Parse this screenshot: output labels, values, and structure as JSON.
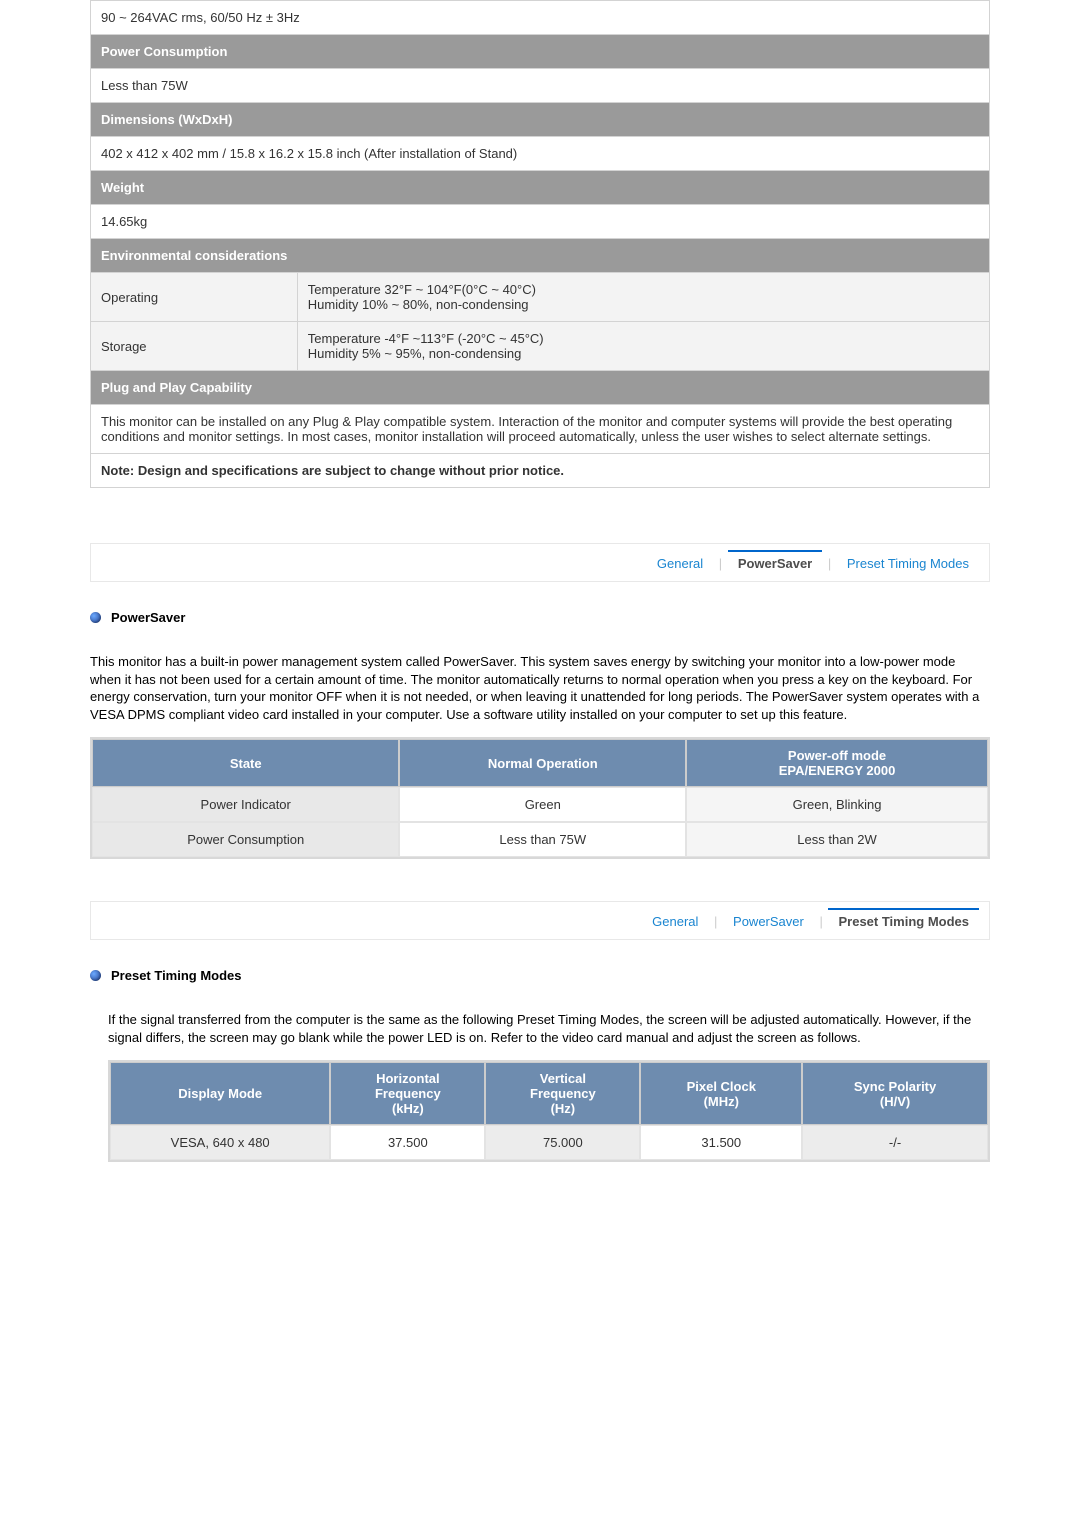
{
  "specs": {
    "voltage": "90 ~ 264VAC rms, 60/50 Hz ± 3Hz",
    "power_consumption_header": "Power Consumption",
    "power_consumption_value": "Less than 75W",
    "dimensions_header": "Dimensions (WxDxH)",
    "dimensions_value": "402 x 412 x 402 mm / 15.8 x 16.2 x 15.8 inch (After installation of Stand)",
    "weight_header": "Weight",
    "weight_value": "14.65kg",
    "env_header": "Environmental considerations",
    "operating_label": "Operating",
    "operating_value": "Temperature 32°F ~ 104°F(0°C ~ 40°C)\nHumidity 10% ~ 80%, non-condensing",
    "storage_label": "Storage",
    "storage_value": "Temperature -4°F ~113°F (-20°C ~ 45°C)\nHumidity 5% ~ 95%, non-condensing",
    "pnp_header": "Plug and Play Capability",
    "pnp_text": "This monitor can be installed on any Plug & Play compatible system. Interaction of the monitor and computer systems will provide the best operating conditions and monitor settings. In most cases, monitor installation will proceed automatically, unless the user wishes to select alternate settings.",
    "note": "Note: Design and specifications are subject to change without prior notice."
  },
  "tabs": {
    "general": "General",
    "powersaver": "PowerSaver",
    "preset": "Preset Timing Modes"
  },
  "powersaver": {
    "title": "PowerSaver",
    "desc": "This monitor has a built-in power management system called PowerSaver. This system saves energy by switching your monitor into a low-power mode when it has not been used for a certain amount of time. The monitor automatically returns to normal operation when you press a key on the keyboard. For energy conservation, turn your monitor OFF when it is not needed, or when leaving it unattended for long periods. The PowerSaver system operates with a VESA DPMS compliant video card installed in your computer. Use a software utility installed on your computer to set up this feature.",
    "col_state": "State",
    "col_normal": "Normal Operation",
    "col_off": "Power-off mode\nEPA/ENERGY 2000",
    "row1_label": "Power Indicator",
    "row1_normal": "Green",
    "row1_off": "Green, Blinking",
    "row2_label": "Power Consumption",
    "row2_normal": "Less than 75W",
    "row2_off": "Less than 2W"
  },
  "preset": {
    "title": "Preset Timing Modes",
    "desc": "If the signal transferred from the computer is the same as the following Preset Timing Modes, the screen will be adjusted automatically. However, if the signal differs, the screen may go blank while the power LED is on. Refer to the video card manual and adjust the screen as follows.",
    "col_mode": "Display Mode",
    "col_hfreq": "Horizontal\nFrequency\n(kHz)",
    "col_vfreq": "Vertical\nFrequency\n(Hz)",
    "col_pixel": "Pixel Clock\n(MHz)",
    "col_sync": "Sync Polarity\n(H/V)",
    "row1_mode": "VESA, 640 x 480",
    "row1_hfreq": "37.500",
    "row1_vfreq": "75.000",
    "row1_pixel": "31.500",
    "row1_sync": "-/-"
  }
}
